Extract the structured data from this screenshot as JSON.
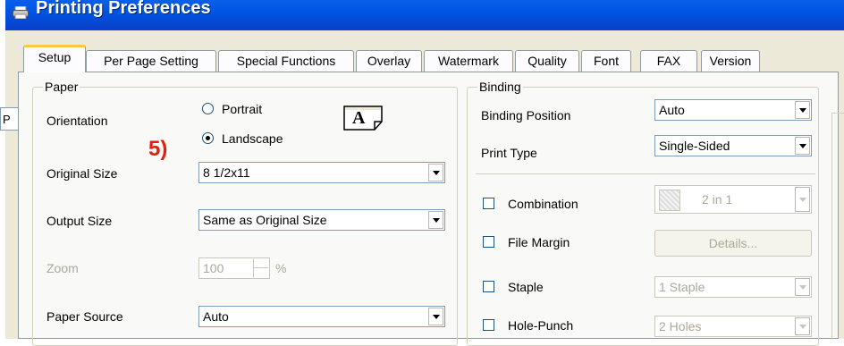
{
  "window": {
    "title": "Printing Preferences",
    "bg_fragment": "P"
  },
  "tabs": [
    {
      "label": "Setup",
      "active": true
    },
    {
      "label": "Per Page Setting",
      "active": false
    },
    {
      "label": "Special Functions",
      "active": false
    },
    {
      "label": "Overlay",
      "active": false
    },
    {
      "label": "Watermark",
      "active": false
    },
    {
      "label": "Quality",
      "active": false
    },
    {
      "label": "Font",
      "active": false
    },
    {
      "label": "FAX",
      "active": false
    },
    {
      "label": "Version",
      "active": false
    }
  ],
  "annotation": "5)",
  "paper": {
    "group_label": "Paper",
    "orientation_label": "Orientation",
    "portrait_label": "Portrait",
    "landscape_label": "Landscape",
    "orientation_selected": "Landscape",
    "orientation_icon_text": "A",
    "original_size_label": "Original Size",
    "original_size_value": "8 1/2x11",
    "output_size_label": "Output Size",
    "output_size_value": "Same as Original Size",
    "zoom_label": "Zoom",
    "zoom_value": "100",
    "zoom_unit": "%",
    "paper_source_label": "Paper Source",
    "paper_source_value": "Auto"
  },
  "binding": {
    "group_label": "Binding",
    "binding_position_label": "Binding Position",
    "binding_position_value": "Auto",
    "print_type_label": "Print Type",
    "print_type_value": "Single-Sided",
    "combination_label": "Combination",
    "combination_value": "2 in 1",
    "file_margin_label": "File Margin",
    "details_button": "Details...",
    "staple_label": "Staple",
    "staple_value": "1 Staple",
    "hole_punch_label": "Hole-Punch",
    "hole_punch_value": "2 Holes"
  },
  "colors": {
    "titlebar": "#0054e3",
    "annotation": "#e02010",
    "tab_highlight": "#ffc83c"
  }
}
